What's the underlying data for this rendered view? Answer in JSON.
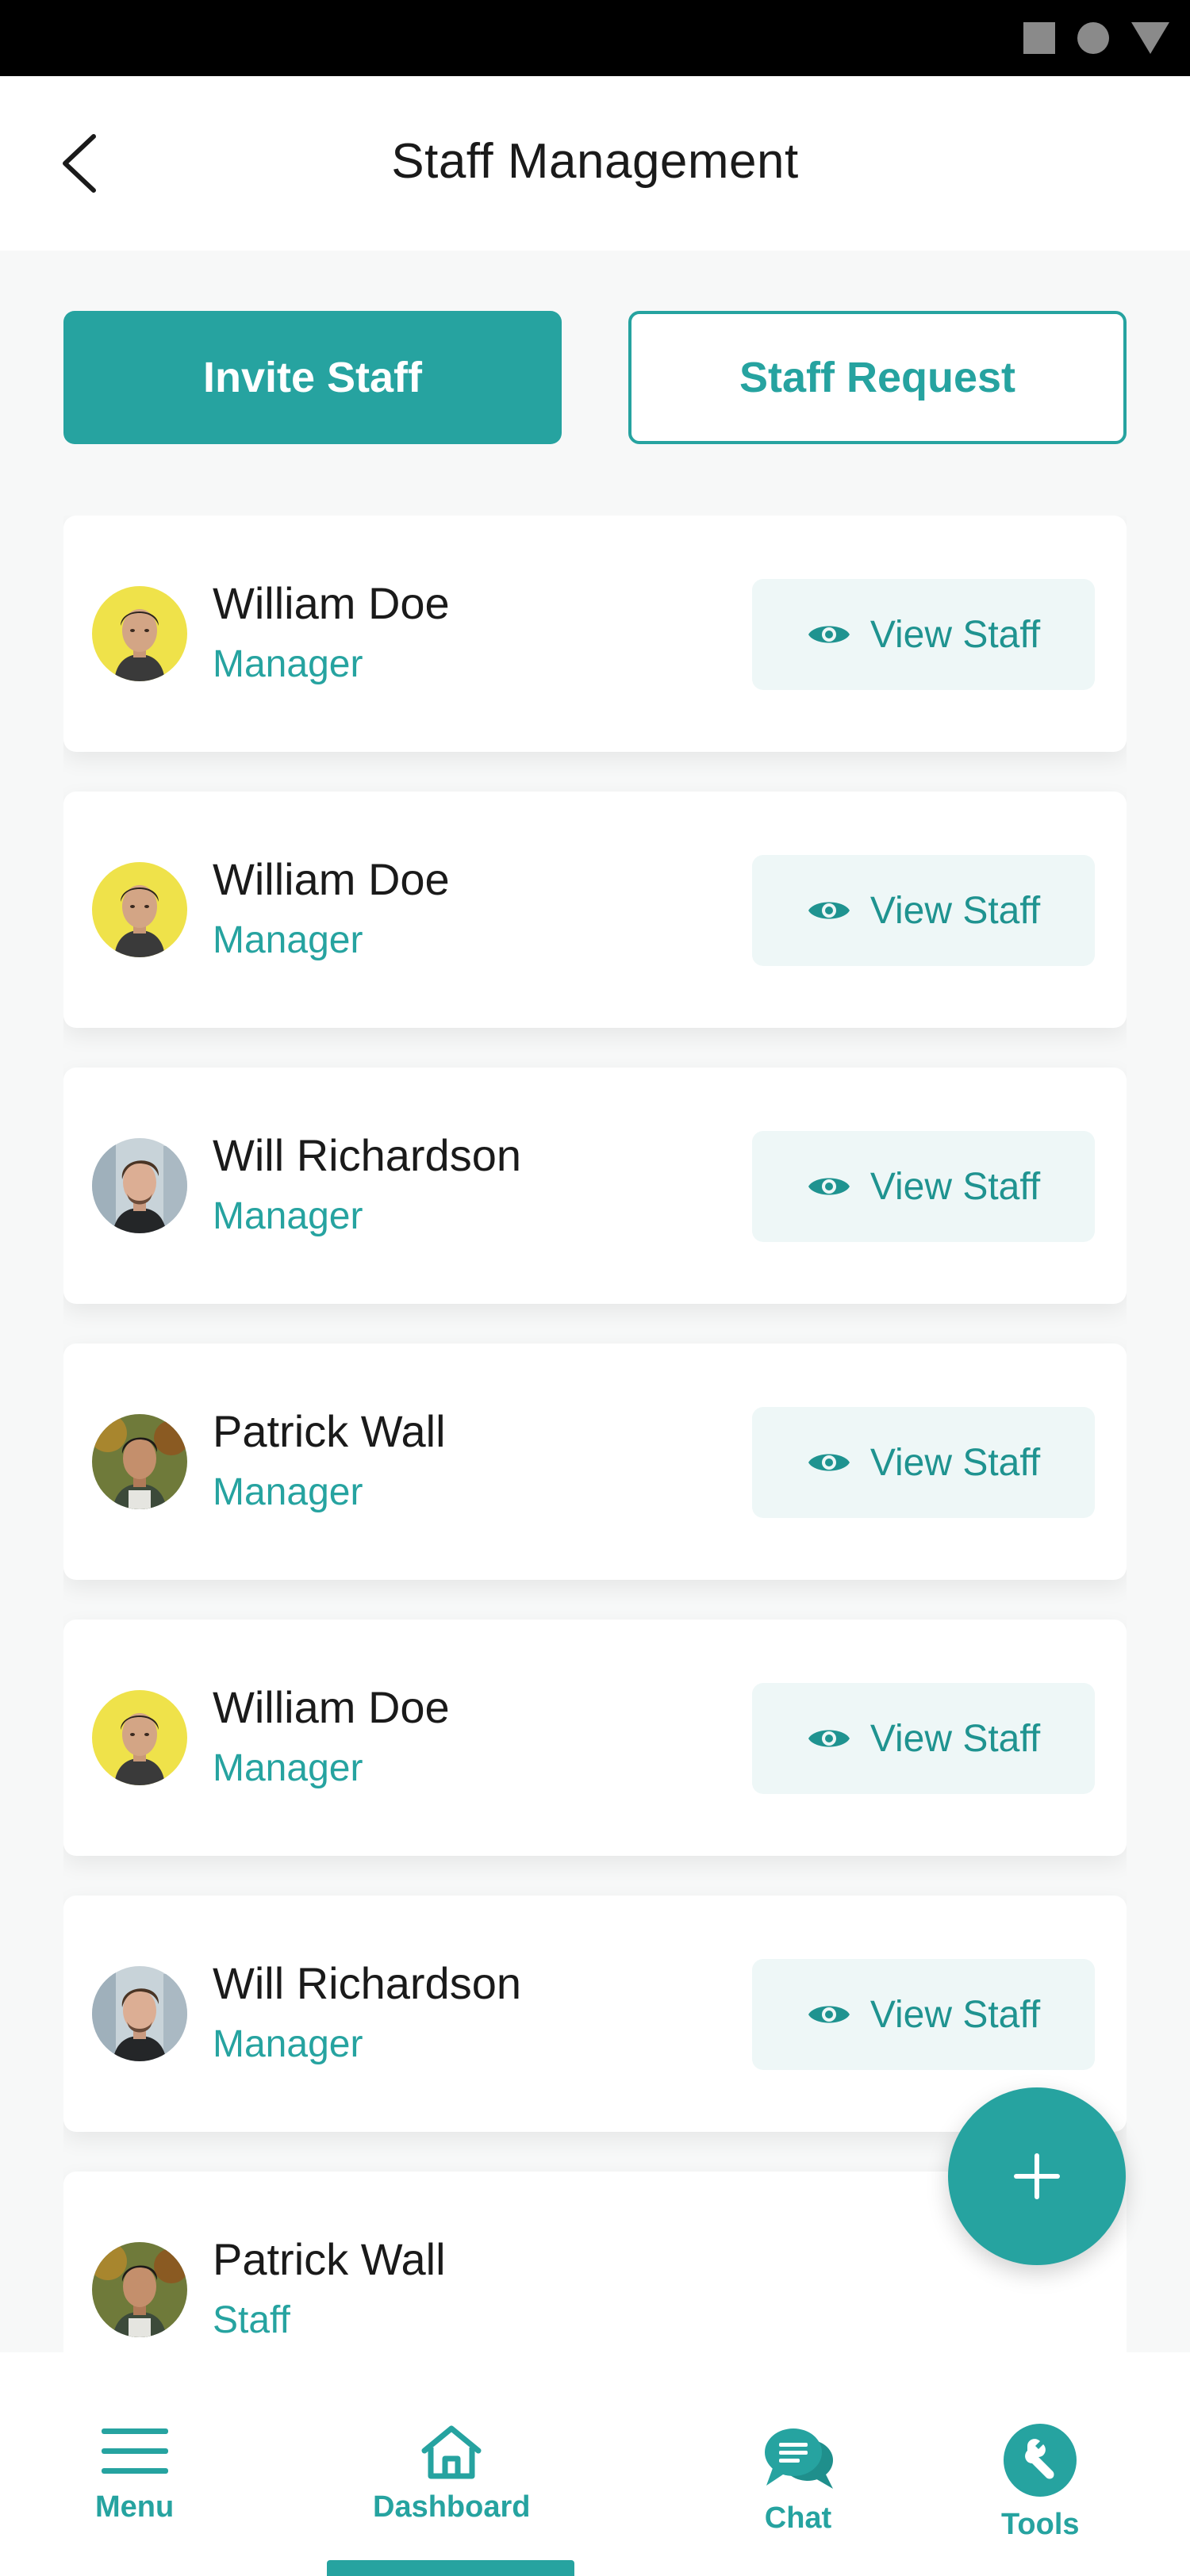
{
  "header": {
    "title": "Staff Management"
  },
  "actions": {
    "invite_label": "Invite Staff",
    "request_label": "Staff Request"
  },
  "staff": [
    {
      "name": "William Doe",
      "role": "Manager",
      "action": "View Staff",
      "avatar": "avatar-william"
    },
    {
      "name": "William Doe",
      "role": "Manager",
      "action": "View Staff",
      "avatar": "avatar-william"
    },
    {
      "name": "Will Richardson",
      "role": "Manager",
      "action": "View Staff",
      "avatar": "avatar-will"
    },
    {
      "name": "Patrick Wall",
      "role": "Manager",
      "action": "View Staff",
      "avatar": "avatar-patrick"
    },
    {
      "name": "William Doe",
      "role": "Manager",
      "action": "View Staff",
      "avatar": "avatar-william"
    },
    {
      "name": "Will Richardson",
      "role": "Manager",
      "action": "View Staff",
      "avatar": "avatar-will"
    },
    {
      "name": "Patrick Wall",
      "role": "Staff",
      "action": "View Staff",
      "avatar": "avatar-patrick"
    }
  ],
  "nav": {
    "items": [
      {
        "label": "Menu",
        "icon": "menu-icon"
      },
      {
        "label": "Dashboard",
        "icon": "home-icon"
      },
      {
        "label": "Chat",
        "icon": "chat-icon"
      },
      {
        "label": "Tools",
        "icon": "tools-icon"
      }
    ],
    "active": "Dashboard"
  },
  "colors": {
    "accent": "#26a3a0",
    "view_button_bg": "#eef7f7",
    "text": "#1a1a1a"
  }
}
